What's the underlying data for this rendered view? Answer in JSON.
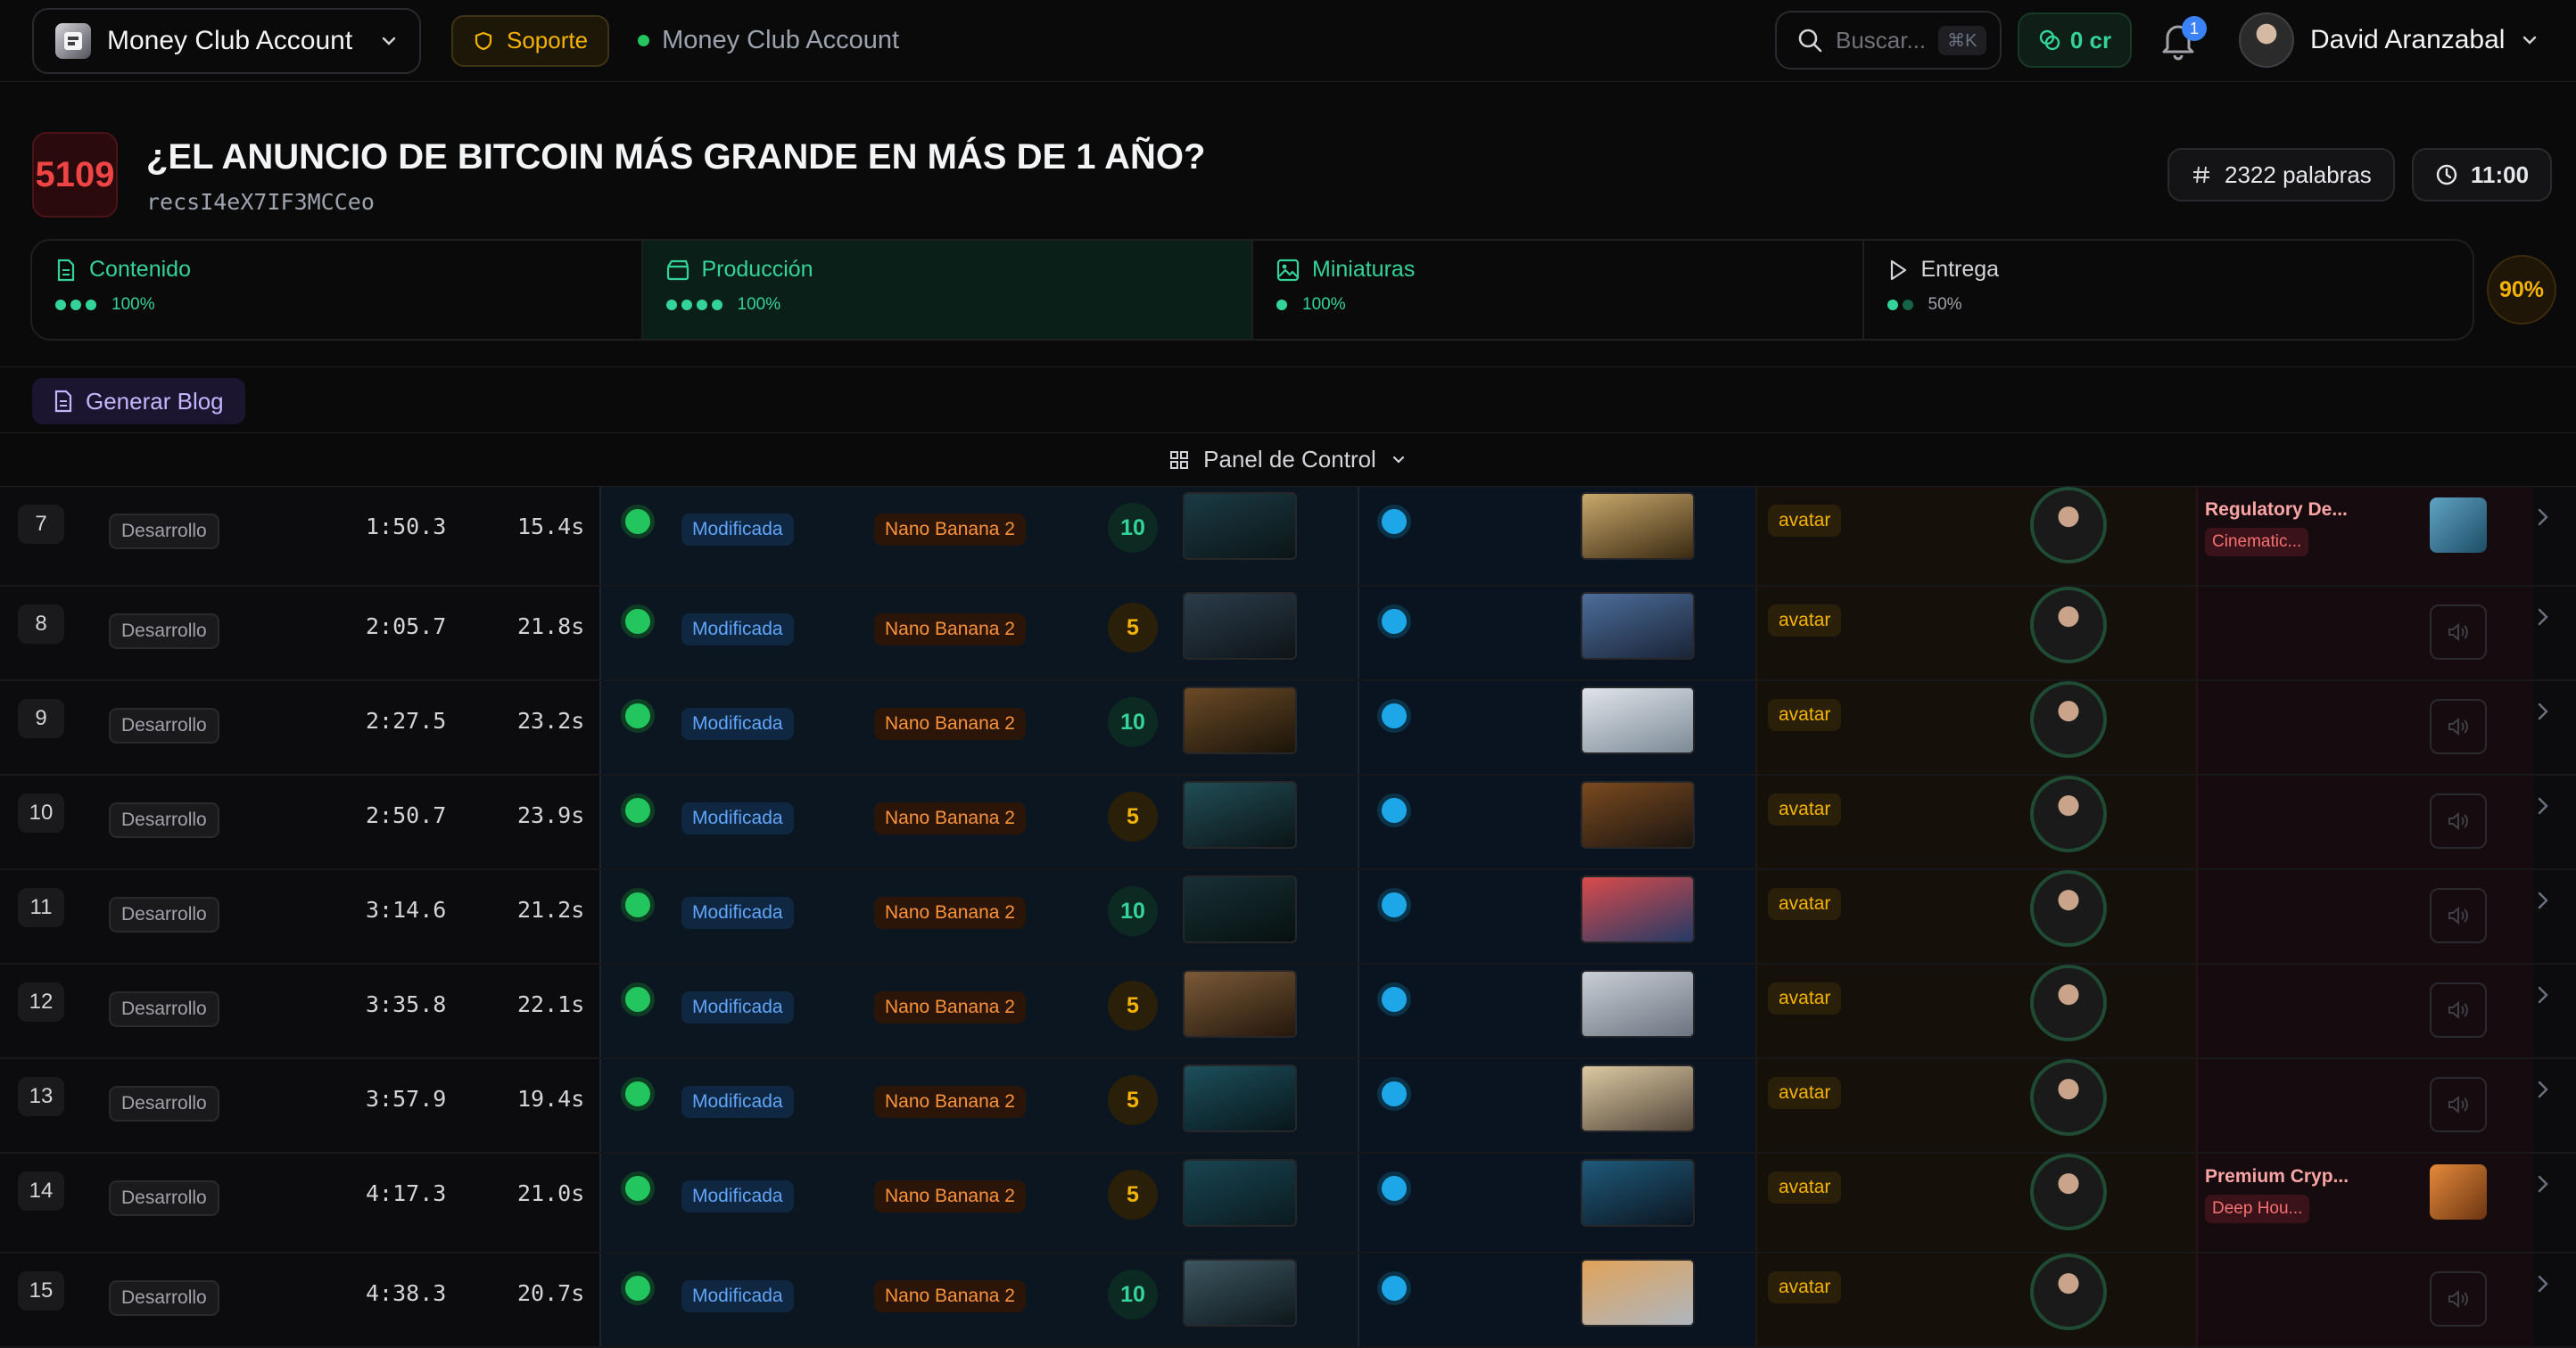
{
  "header": {
    "account_name": "Money Club Account",
    "support_label": "Soporte",
    "breadcrumb_label": "Money Club Account",
    "search_placeholder": "Buscar...",
    "search_shortcut": "⌘K",
    "credits": "0 cr",
    "notifications_count": "1",
    "user_name": "David Aranzabal"
  },
  "project": {
    "id": "5109",
    "title": "¿EL ANUNCIO DE BITCOIN MÁS GRANDE EN MÁS DE 1 AÑO?",
    "record_id": "recsI4eX7IF3MCCeo",
    "word_count": "2322 palabras",
    "duration": "11:00",
    "overall_progress": "90%"
  },
  "stages": [
    {
      "label": "Contenido",
      "progress": "100%",
      "dots_on": 3,
      "dots_total": 3,
      "icon": "document-icon"
    },
    {
      "label": "Producción",
      "progress": "100%",
      "dots_on": 4,
      "dots_total": 4,
      "icon": "clapperboard-icon"
    },
    {
      "label": "Miniaturas",
      "progress": "100%",
      "dots_on": 1,
      "dots_total": 1,
      "icon": "image-icon"
    },
    {
      "label": "Entrega",
      "progress": "50%",
      "dots_on": 1,
      "dots_total": 2,
      "icon": "play-icon"
    }
  ],
  "actions": {
    "generate_blog": "Generar Blog",
    "control_panel": "Panel de Control"
  },
  "rows": [
    {
      "n": "7",
      "status": "Desarrollo",
      "start": "1:50.3",
      "dur": "15.4s",
      "change": "Modificada",
      "model": "Nano Banana 2",
      "score": "10",
      "avatar_tag": "avatar",
      "music_title": "Regulatory De...",
      "music_genre": "Cinematic..."
    },
    {
      "n": "8",
      "status": "Desarrollo",
      "start": "2:05.7",
      "dur": "21.8s",
      "change": "Modificada",
      "model": "Nano Banana 2",
      "score": "5",
      "avatar_tag": "avatar"
    },
    {
      "n": "9",
      "status": "Desarrollo",
      "start": "2:27.5",
      "dur": "23.2s",
      "change": "Modificada",
      "model": "Nano Banana 2",
      "score": "10",
      "avatar_tag": "avatar"
    },
    {
      "n": "10",
      "status": "Desarrollo",
      "start": "2:50.7",
      "dur": "23.9s",
      "change": "Modificada",
      "model": "Nano Banana 2",
      "score": "5",
      "avatar_tag": "avatar"
    },
    {
      "n": "11",
      "status": "Desarrollo",
      "start": "3:14.6",
      "dur": "21.2s",
      "change": "Modificada",
      "model": "Nano Banana 2",
      "score": "10",
      "avatar_tag": "avatar"
    },
    {
      "n": "12",
      "status": "Desarrollo",
      "start": "3:35.8",
      "dur": "22.1s",
      "change": "Modificada",
      "model": "Nano Banana 2",
      "score": "5",
      "avatar_tag": "avatar"
    },
    {
      "n": "13",
      "status": "Desarrollo",
      "start": "3:57.9",
      "dur": "19.4s",
      "change": "Modificada",
      "model": "Nano Banana 2",
      "score": "5",
      "avatar_tag": "avatar"
    },
    {
      "n": "14",
      "status": "Desarrollo",
      "start": "4:17.3",
      "dur": "21.0s",
      "change": "Modificada",
      "model": "Nano Banana 2",
      "score": "5",
      "avatar_tag": "avatar",
      "music_title": "Premium Cryp...",
      "music_genre": "Deep Hou..."
    },
    {
      "n": "15",
      "status": "Desarrollo",
      "start": "4:38.3",
      "dur": "20.7s",
      "change": "Modificada",
      "model": "Nano Banana 2",
      "score": "10",
      "avatar_tag": "avatar"
    }
  ],
  "colors": {
    "accent_green": "#34d399",
    "accent_amber": "#f5b300",
    "accent_blue": "#60a5fa",
    "accent_red": "#ef4444"
  }
}
